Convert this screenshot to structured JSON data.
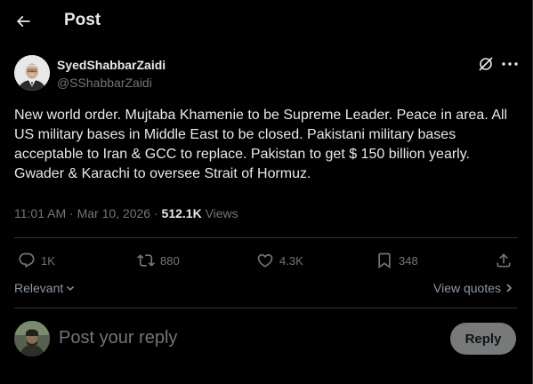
{
  "header": {
    "title": "Post",
    "back_icon": "arrow-left-icon"
  },
  "post": {
    "author": {
      "display_name": "SyedShabbarZaidi",
      "handle": "@SShabbarZaidi",
      "avatar_icon": "user-avatar"
    },
    "text": "New world order. Mujtaba Khamenie to be Supreme Leader. Peace in area. All US military bases in Middle East to be closed. Pakistani military bases acceptable to Iran & GCC to replace. Pakistan to get $ 150 billion yearly.  Gwader & Karachi to oversee Strait of Hormuz.",
    "time": "11:01 AM",
    "separator": "·",
    "date": "Mar 10, 2026",
    "dot": "·",
    "views_count": "512.1K",
    "views_label": "Views"
  },
  "actions": {
    "replies": "1K",
    "reposts": "880",
    "likes": "4.3K",
    "bookmarks": "348"
  },
  "sort": {
    "label": "Relevant"
  },
  "quotes": {
    "label": "View quotes"
  },
  "reply_box": {
    "placeholder": "Post your reply",
    "button_label": "Reply"
  },
  "colors": {
    "background": "#000000",
    "text": "#e7e9ea",
    "muted": "#71767b",
    "divider": "#2f3336",
    "reply_button": "#787a7a"
  }
}
